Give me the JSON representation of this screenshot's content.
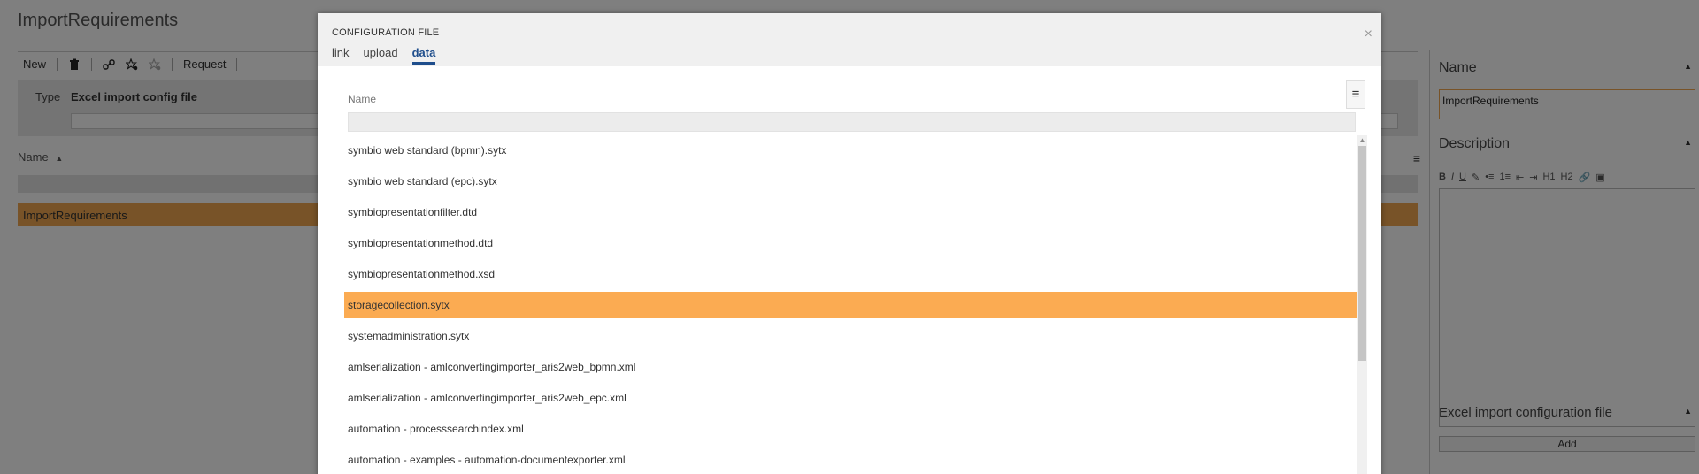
{
  "app": {
    "title": "ImportRequirements"
  },
  "toolbar": {
    "new_label": "New",
    "request_label": "Request",
    "icons": [
      "trash-icon",
      "link-icon",
      "star-gear-icon",
      "star-gear-disabled-icon"
    ]
  },
  "type_panel": {
    "label": "Type",
    "value": "Excel import config file"
  },
  "list": {
    "header": "Name",
    "sort_icon": "sort-asc-icon",
    "selected_item": "ImportRequirements"
  },
  "right_panel": {
    "name_title": "Name",
    "name_value": "ImportRequirements",
    "description_title": "Description",
    "editor_buttons": [
      "B",
      "I",
      "U",
      "✎",
      "•≡",
      "1≡",
      "⇤",
      "⇥",
      "H1",
      "H2",
      "🔗",
      "▣"
    ],
    "config_title": "Excel import configuration file",
    "add_label": "Add"
  },
  "modal": {
    "title": "CONFIGURATION FILE",
    "close_glyph": "×",
    "tabs": [
      {
        "label": "link",
        "active": false
      },
      {
        "label": "upload",
        "active": false
      },
      {
        "label": "data",
        "active": true
      }
    ],
    "column_header": "Name",
    "rows": [
      {
        "name": "symbio web standard (bpmn).sytx",
        "selected": false
      },
      {
        "name": "symbio web standard (epc).sytx",
        "selected": false
      },
      {
        "name": "symbiopresentationfilter.dtd",
        "selected": false
      },
      {
        "name": "symbiopresentationmethod.dtd",
        "selected": false
      },
      {
        "name": "symbiopresentationmethod.xsd",
        "selected": false
      },
      {
        "name": "storagecollection.sytx",
        "selected": true
      },
      {
        "name": "systemadministration.sytx",
        "selected": false
      },
      {
        "name": "amlserialization - amlconvertingimporter_aris2web_bpmn.xml",
        "selected": false
      },
      {
        "name": "amlserialization - amlconvertingimporter_aris2web_epc.xml",
        "selected": false
      },
      {
        "name": "automation - processsearchindex.xml",
        "selected": false
      },
      {
        "name": "automation - examples - automation-documentexporter.xml",
        "selected": false
      }
    ]
  },
  "colors": {
    "selection": "#fbab52",
    "tab_active": "#1f4e8c",
    "overlay": "rgba(0,0,0,0.5)"
  }
}
